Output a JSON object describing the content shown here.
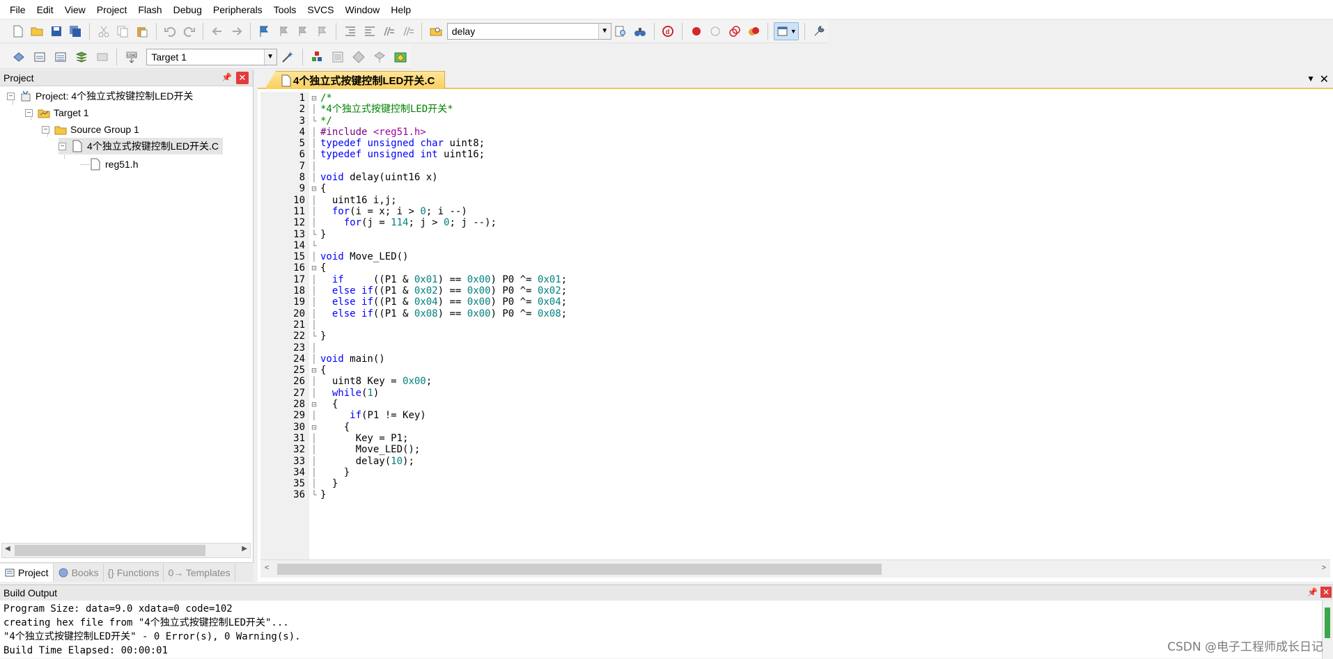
{
  "menu": [
    "File",
    "Edit",
    "View",
    "Project",
    "Flash",
    "Debug",
    "Peripherals",
    "Tools",
    "SVCS",
    "Window",
    "Help"
  ],
  "toolbar1": {
    "find_combo_value": "delay"
  },
  "toolbar2": {
    "target_combo_value": "Target 1"
  },
  "project_panel": {
    "title": "Project",
    "project_label": "Project: 4个独立式按键控制LED开关",
    "target_label": "Target 1",
    "group_label": "Source Group 1",
    "file_label": "4个独立式按键控制LED开关.C",
    "header_label": "reg51.h",
    "tabs": [
      "Project",
      "Books",
      "{} Functions",
      "0→ Templates"
    ]
  },
  "editor": {
    "tab_title": "4个独立式按键控制LED开关.C",
    "lines": [
      "/*",
      "*4个独立式按键控制LED开关*",
      "*/",
      "#include <reg51.h>",
      "typedef unsigned char uint8;",
      "typedef unsigned int uint16;",
      "",
      "void delay(uint16 x)",
      "{",
      "  uint16 i,j;",
      "  for(i = x; i > 0; i --)",
      "    for(j = 114; j > 0; j --);",
      "}",
      "",
      "void Move_LED()",
      "{",
      "  if     ((P1 & 0x01) == 0x00) P0 ^= 0x01;",
      "  else if((P1 & 0x02) == 0x00) P0 ^= 0x02;",
      "  else if((P1 & 0x04) == 0x00) P0 ^= 0x04;",
      "  else if((P1 & 0x08) == 0x00) P0 ^= 0x08;",
      "",
      "}",
      "",
      "void main()",
      "{",
      "  uint8 Key = 0x00;",
      "  while(1)",
      "  {",
      "     if(P1 != Key)",
      "    {",
      "      Key = P1;",
      "      Move_LED();",
      "      delay(10);",
      "    }",
      "  }",
      "}"
    ]
  },
  "build_output": {
    "title": "Build Output",
    "lines": [
      "Program Size: data=9.0 xdata=0 code=102",
      "creating hex file from \"4个独立式按键控制LED开关\"...",
      "\"4个独立式按键控制LED开关\" - 0 Error(s), 0 Warning(s).",
      "Build Time Elapsed:  00:00:01"
    ]
  },
  "watermark": "CSDN @电子工程师成长日记"
}
